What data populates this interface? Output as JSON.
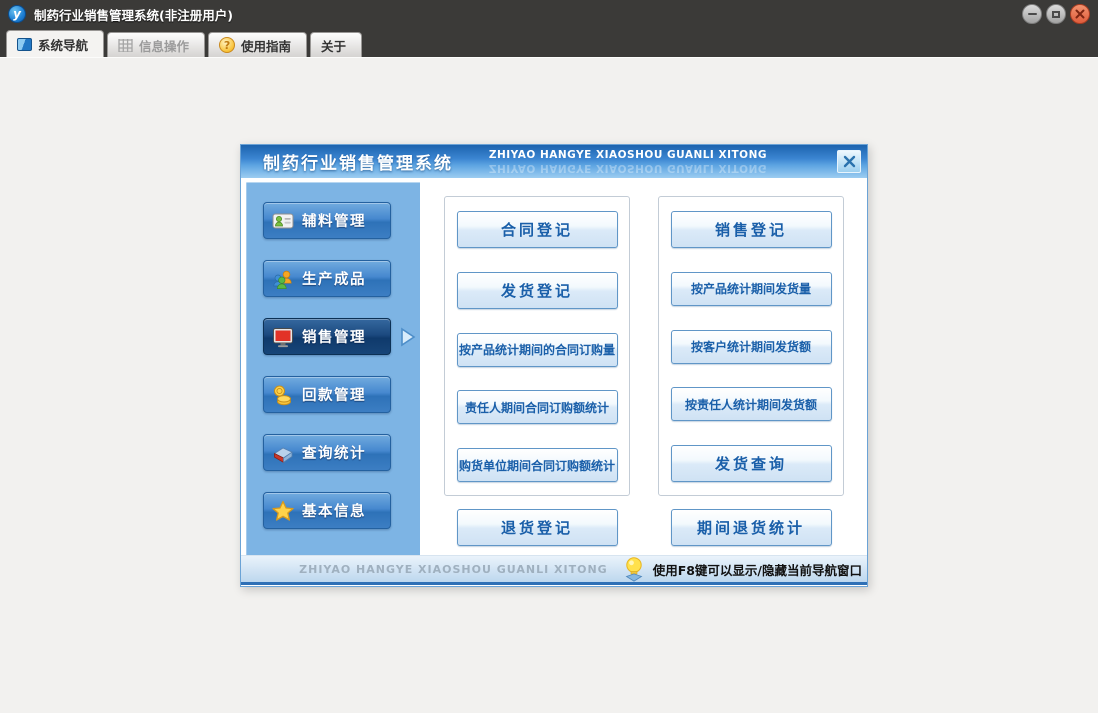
{
  "colors": {
    "titlebar_dark": "#3b3a38",
    "dialog_title_blue": "#3c86d2",
    "sidebar_panel_blue": "#7db4e4",
    "nav_button_blue": "#2e72b8",
    "nav_selected_navy": "#0f3a6c",
    "action_button_text": "#1a5fa9",
    "footer_border_blue": "#2f70b6",
    "close_button_red": "#e05c3c"
  },
  "window": {
    "title": "制药行业销售管理系统(非注册用户)",
    "logo_letter": "y"
  },
  "tabs": [
    {
      "label": "系统导航"
    },
    {
      "label": "信息操作"
    },
    {
      "label": "使用指南"
    },
    {
      "label": "关于"
    }
  ],
  "dialog": {
    "title": "制药行业销售管理系统",
    "subtitle": "ZHIYAO HANGYE XIAOSHOU GUANLI XITONG",
    "sidebar": [
      {
        "label": "辅料管理",
        "icon": "id-card-icon"
      },
      {
        "label": "生产成品",
        "icon": "people-icon"
      },
      {
        "label": "销售管理",
        "icon": "monitor-icon",
        "selected": true
      },
      {
        "label": "回款管理",
        "icon": "coins-icon"
      },
      {
        "label": "查询统计",
        "icon": "book-icon"
      },
      {
        "label": "基本信息",
        "icon": "star-icon"
      }
    ],
    "left_column": {
      "group": [
        "合同登记",
        "发货登记",
        "按产品统计期间的合同订购量",
        "责任人期间合同订购额统计",
        "购货单位期间合同订购额统计"
      ],
      "bottom": "退货登记"
    },
    "right_column": {
      "group": [
        "销售登记",
        "按产品统计期间发货量",
        "按客户统计期间发货额",
        "按责任人统计期间发货额",
        "发货查询"
      ],
      "bottom": "期间退货统计"
    },
    "footer": {
      "watermark": "ZHIYAO HANGYE XIAOSHOU GUANLI XITONG",
      "hint": "使用F8键可以显示/隐藏当前导航窗口"
    }
  }
}
